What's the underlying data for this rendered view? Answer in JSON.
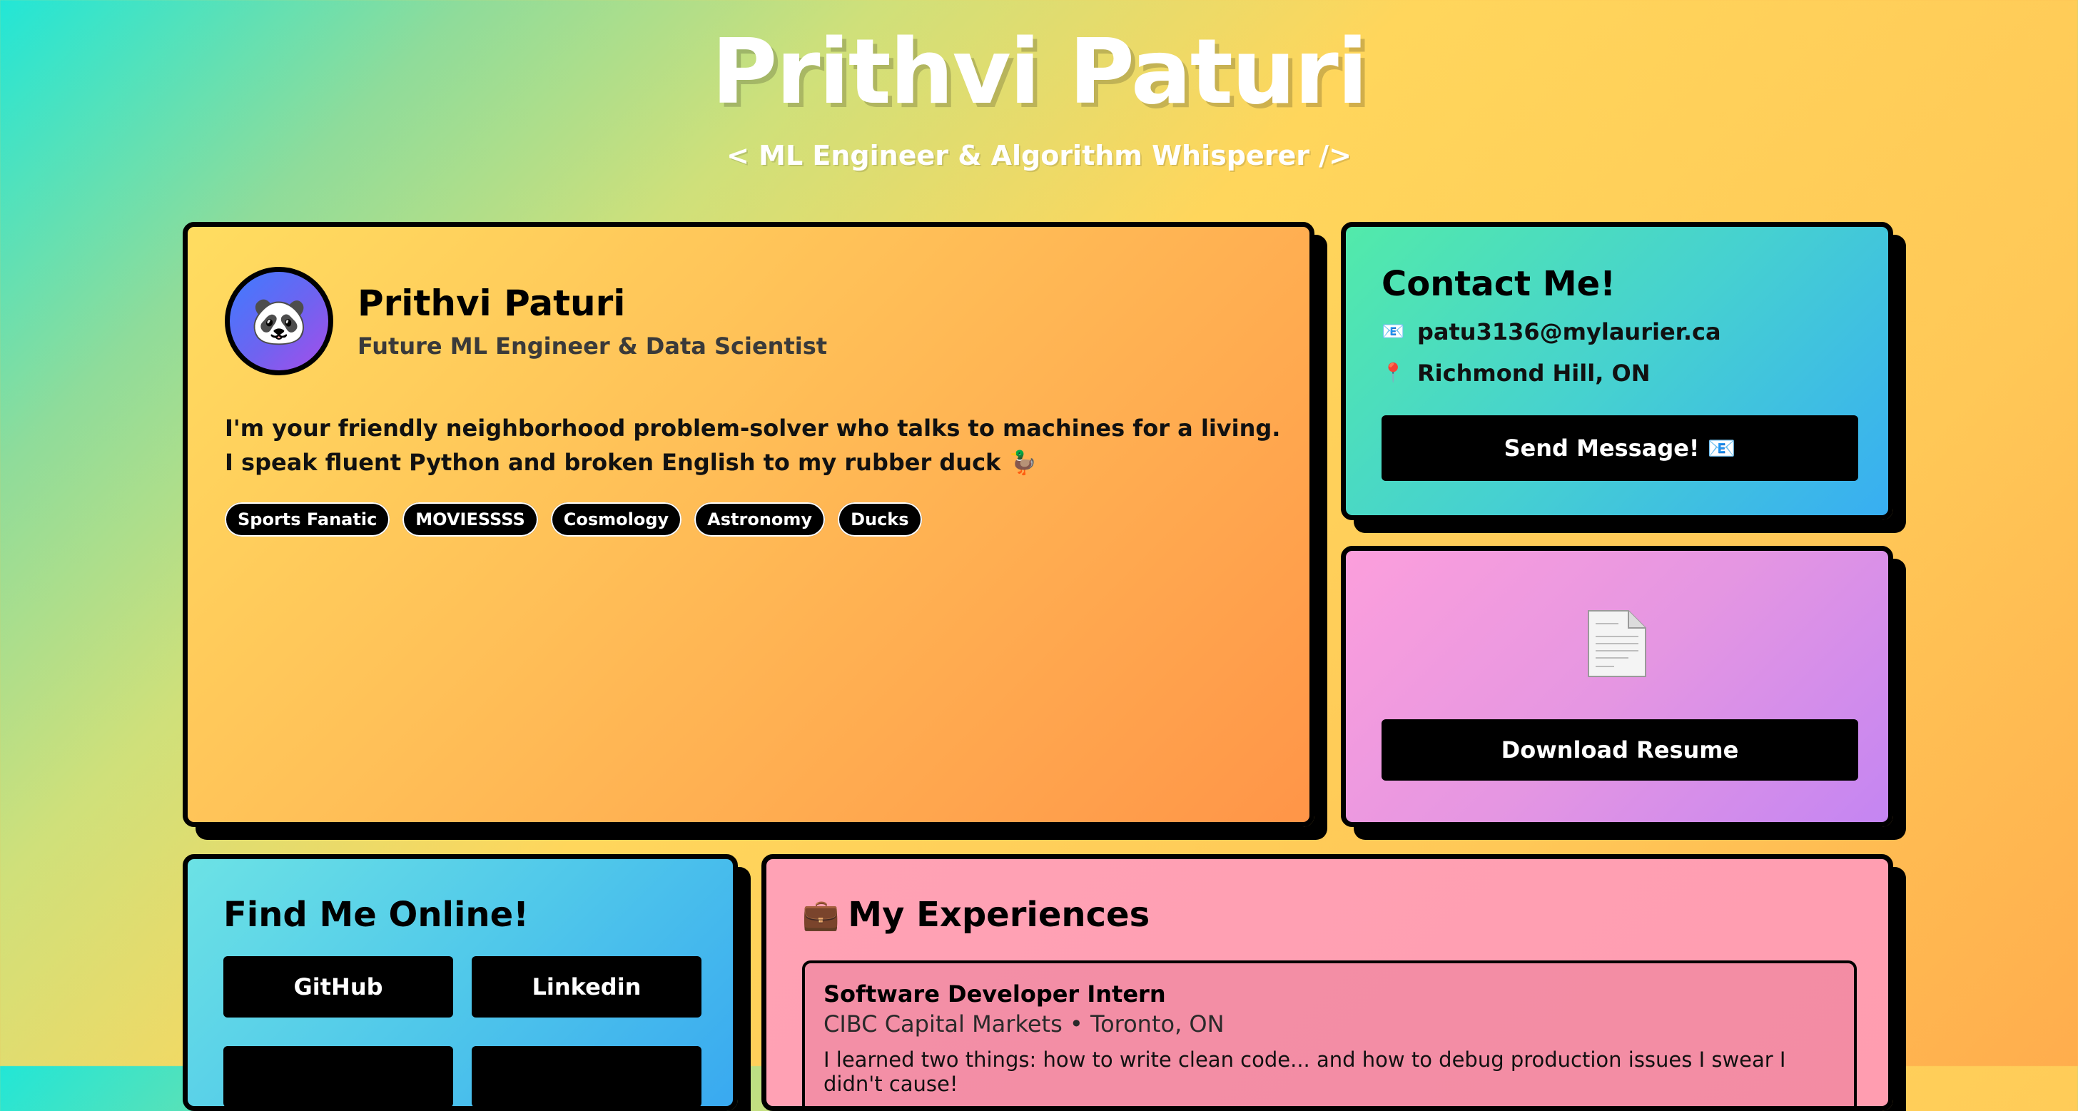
{
  "header": {
    "title": "Prithvi Paturi",
    "subtitle": "< ML Engineer & Algorithm Whisperer />"
  },
  "about": {
    "avatar_emoji": "🐼",
    "name": "Prithvi Paturi",
    "role": "Future ML Engineer & Data Scientist",
    "bio": "I'm your friendly neighborhood problem-solver who talks to machines for a living. I speak fluent Python and broken English to my rubber duck 🦆",
    "tags": [
      "Sports Fanatic",
      "MOVIESSSS",
      "Cosmology",
      "Astronomy",
      "Ducks"
    ]
  },
  "contact": {
    "heading": "Contact Me!",
    "email_icon": "📧",
    "email": "patu3136@mylaurier.ca",
    "location_icon": "📍",
    "location": "Richmond Hill, ON",
    "send_label": "Send Message! 📧"
  },
  "resume": {
    "icon": "📄",
    "download_label": "Download Resume"
  },
  "online": {
    "heading": "Find Me Online!",
    "links": [
      "GitHub",
      "Linkedin"
    ]
  },
  "experiences": {
    "icon": "💼",
    "heading": "My Experiences",
    "items": [
      {
        "title": "Software Developer Intern",
        "meta": "CIBC Capital Markets • Toronto, ON",
        "desc": "I learned two things: how to write clean code... and how to debug production issues I swear I didn't cause!"
      }
    ]
  },
  "colors": {
    "border": "#000000",
    "button_bg": "#000000",
    "button_text": "#ffffff"
  }
}
